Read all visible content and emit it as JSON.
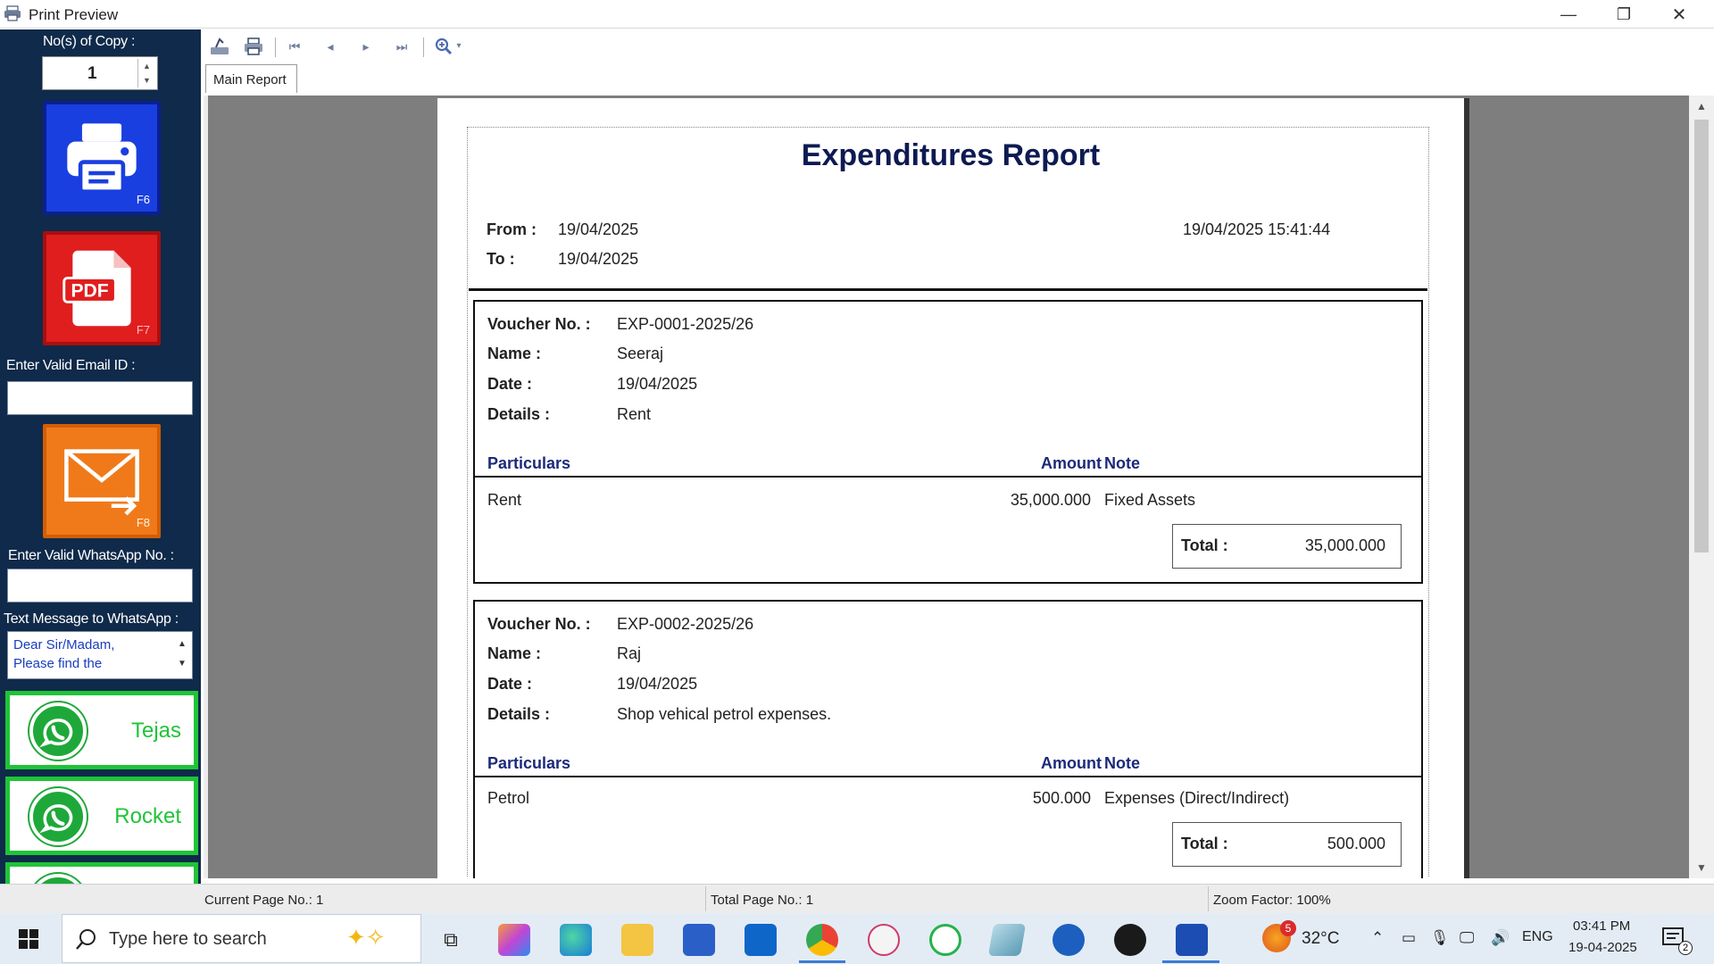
{
  "window": {
    "title": "Print Preview",
    "minimize_glyph": "—",
    "restore_glyph": "❐",
    "close_glyph": "✕"
  },
  "left_panel": {
    "copies_label": "No(s) of Copy :",
    "copies_value": "1",
    "print_key": "F6",
    "pdf_key": "F7",
    "pdf_text": "PDF",
    "email_label": "Enter Valid Email ID :",
    "email_value": "",
    "email_key": "F8",
    "whatsapp_no_label": "Enter Valid WhatsApp No. :",
    "whatsapp_no_value": "",
    "message_label": "Text Message to WhatsApp :",
    "message_text": "Dear Sir/Madam,\nPlease find the",
    "whatsapp_buttons": [
      "Tejas",
      "Rocket"
    ]
  },
  "toolbar": {
    "icons": [
      "export-icon",
      "print-icon",
      "first-page-icon",
      "previous-page-icon",
      "next-page-icon",
      "last-page-icon",
      "zoom-icon"
    ],
    "tab_label": "Main Report"
  },
  "report": {
    "title": "Expenditures Report",
    "from_label": "From :",
    "from_value": "19/04/2025",
    "to_label": "To :",
    "to_value": "19/04/2025",
    "printed_at": "19/04/2025  15:41:44",
    "labels": {
      "voucher": "Voucher No. :",
      "name": "Name :",
      "date": "Date :",
      "details": "Details :",
      "particulars": "Particulars",
      "amount": "Amount",
      "note": "Note",
      "total": "Total :"
    },
    "vouchers": [
      {
        "voucher_no": "EXP-0001-2025/26",
        "name": "Seeraj",
        "date": "19/04/2025",
        "details": "Rent",
        "item_particular": "Rent",
        "item_amount": "35,000.000",
        "item_note": "Fixed Assets",
        "total": "35,000.000"
      },
      {
        "voucher_no": "EXP-0002-2025/26",
        "name": "Raj",
        "date": "19/04/2025",
        "details": "Shop vehical petrol expenses.",
        "item_particular": "Petrol",
        "item_amount": "500.000",
        "item_note": "Expenses (Direct/Indirect)",
        "total": "500.000"
      }
    ]
  },
  "status": {
    "current_page": "Current Page No.: 1",
    "total_page": "Total Page No.: 1",
    "zoom": "Zoom Factor: 100%"
  },
  "taskbar": {
    "search_placeholder": "Type here to search",
    "weather_badge": "5",
    "temperature": "32°C",
    "language": "ENG",
    "time": "03:41 PM",
    "date": "19-04-2025",
    "notification_count": "2"
  },
  "colors": {
    "panel_bg": "#0f2a4a",
    "print_button": "#1a3fe0",
    "pdf_button": "#e01e1e",
    "email_button": "#f07a1a",
    "whatsapp_green": "#1fc437",
    "report_title": "#0e1a52",
    "report_header": "#1b2a7a"
  }
}
